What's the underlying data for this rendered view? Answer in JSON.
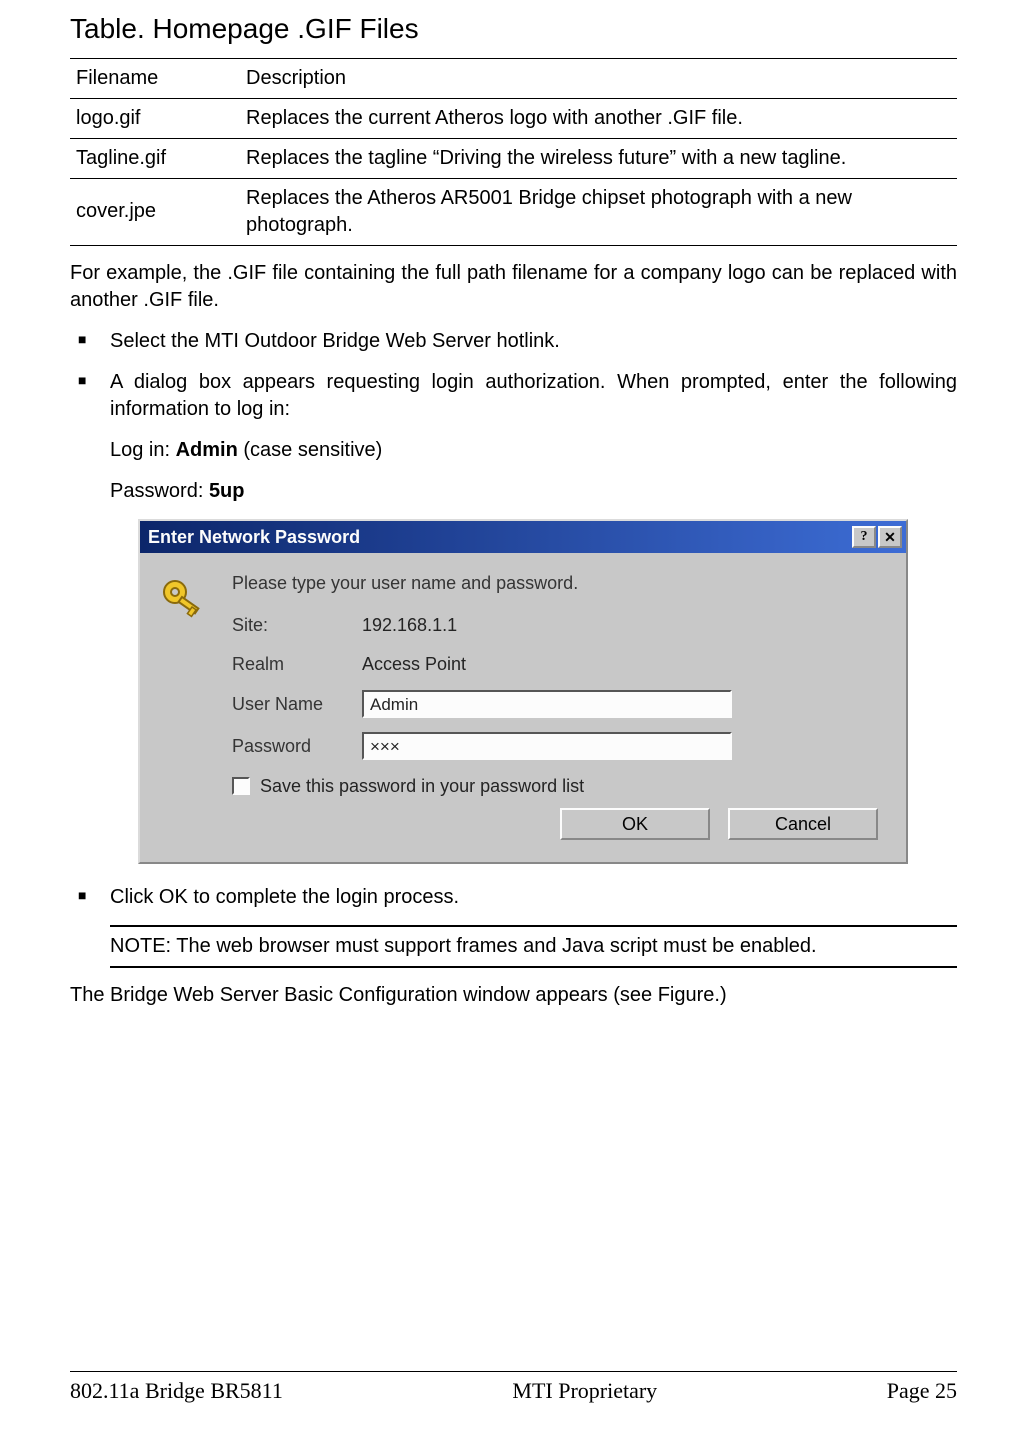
{
  "title": "Table. Homepage .GIF Files",
  "table": {
    "headers": {
      "filename": "Filename",
      "description": "Description"
    },
    "rows": [
      {
        "filename": "logo.gif",
        "description": "Replaces the current Atheros logo with another .GIF file."
      },
      {
        "filename": "Tagline.gif",
        "description": "Replaces the tagline  “Driving the wireless future”  with a new tagline."
      },
      {
        "filename": "cover.jpe",
        "description": "Replaces the Atheros AR5001 Bridge chipset photograph with a new photograph."
      }
    ]
  },
  "para_example": "For example, the .GIF file containing the full path filename for a company logo can be replaced with another .GIF file.",
  "bullets": {
    "b1": "Select the MTI Outdoor Bridge Web Server hotlink.",
    "b2": "A dialog box appears requesting login authorization. When prompted, enter the following information to log in:",
    "b3": "Click OK to complete the login process."
  },
  "login_info": {
    "login_label": "Log in: ",
    "login_value": "Admin",
    "login_suffix": " (case sensitive)",
    "password_label": "Password: ",
    "password_value": "5up"
  },
  "dialog": {
    "title": "Enter Network Password",
    "help_glyph": "?",
    "close_glyph": "✕",
    "prompt": "Please type your user name and password.",
    "labels": {
      "site": "Site:",
      "realm": "Realm",
      "username": "User Name",
      "password": "Password"
    },
    "values": {
      "site": "192.168.1.1",
      "realm": "Access Point",
      "username": "Admin",
      "password": "×××"
    },
    "checkbox_label": "Save this password in your password list",
    "buttons": {
      "ok": "OK",
      "cancel": "Cancel"
    }
  },
  "note": "NOTE: The web browser must support frames and Java script must be enabled.",
  "closing_para": "The Bridge Web Server Basic Configuration window appears (see Figure.)",
  "footer": {
    "left": "802.11a Bridge BR5811",
    "center": "MTI Proprietary",
    "right": "Page 25"
  }
}
